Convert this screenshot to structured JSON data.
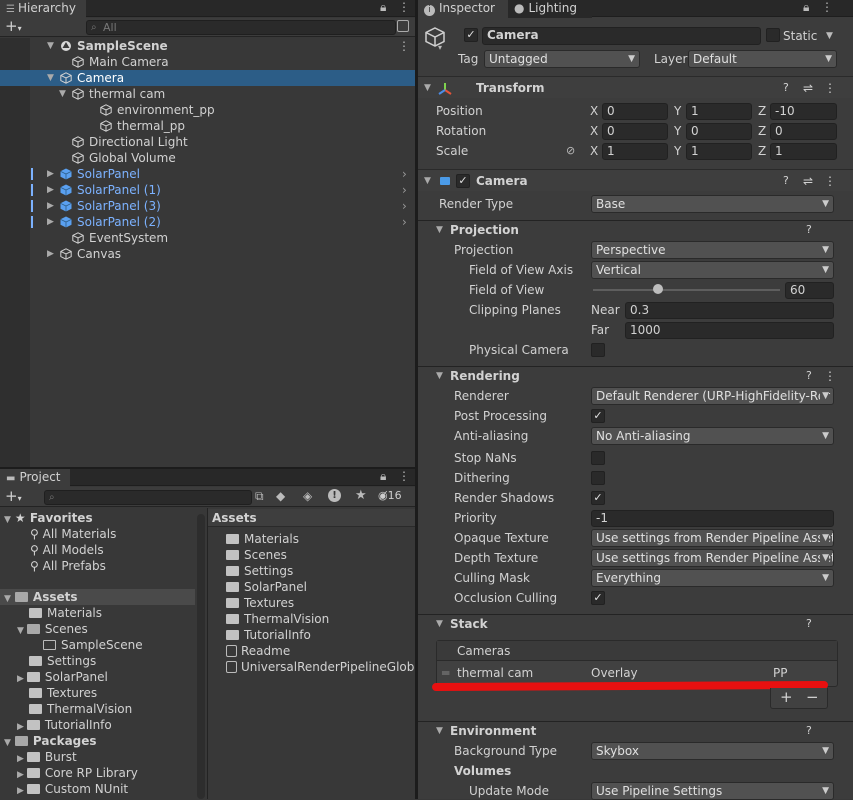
{
  "hierarchy": {
    "tab": "Hierarchy",
    "search_placeholder": "All",
    "add_label": "+",
    "items": [
      {
        "label": "SampleScene",
        "bold": true
      },
      {
        "label": "Main Camera"
      },
      {
        "label": "Camera",
        "selected": true
      },
      {
        "label": "thermal cam"
      },
      {
        "label": "environment_pp"
      },
      {
        "label": "thermal_pp"
      },
      {
        "label": "Directional Light"
      },
      {
        "label": "Global Volume"
      },
      {
        "label": "SolarPanel",
        "prefab": true
      },
      {
        "label": "SolarPanel (1)",
        "prefab": true
      },
      {
        "label": "SolarPanel (3)",
        "prefab": true
      },
      {
        "label": "SolarPanel (2)",
        "prefab": true
      },
      {
        "label": "EventSystem"
      },
      {
        "label": "Canvas"
      }
    ]
  },
  "project": {
    "tab": "Project",
    "add_label": "+",
    "hidden_count": "16",
    "favorites": {
      "label": "Favorites",
      "items": [
        "All Materials",
        "All Models",
        "All Prefabs"
      ]
    },
    "tree": {
      "assets_label": "Assets",
      "items": [
        "Materials",
        "Scenes",
        "SampleScene",
        "Settings",
        "SolarPanel",
        "Textures",
        "ThermalVision",
        "TutorialInfo"
      ],
      "packages_label": "Packages",
      "packages": [
        "Burst",
        "Core RP Library",
        "Custom NUnit"
      ]
    },
    "assets_header": "Assets",
    "assets_list": [
      "Materials",
      "Scenes",
      "Settings",
      "SolarPanel",
      "Textures",
      "ThermalVision",
      "TutorialInfo",
      "Readme",
      "UniversalRenderPipelineGlobal"
    ]
  },
  "inspector": {
    "tab": "Inspector",
    "tab2": "Lighting",
    "object_name": "Camera",
    "static_label": "Static",
    "tag_label": "Tag",
    "tag_value": "Untagged",
    "layer_label": "Layer",
    "layer_value": "Default",
    "transform": {
      "title": "Transform",
      "position_label": "Position",
      "position": [
        "0",
        "1",
        "-10"
      ],
      "rotation_label": "Rotation",
      "rotation": [
        "0",
        "0",
        "0"
      ],
      "scale_label": "Scale",
      "scale": [
        "1",
        "1",
        "1"
      ],
      "axis": [
        "X",
        "Y",
        "Z"
      ]
    },
    "camera": {
      "title": "Camera",
      "render_type_label": "Render Type",
      "render_type": "Base",
      "projection_section": "Projection",
      "projection_label": "Projection",
      "projection": "Perspective",
      "fov_axis_label": "Field of View Axis",
      "fov_axis": "Vertical",
      "fov_label": "Field of View",
      "fov": "60",
      "fov_fraction": 0.345,
      "clipping_label": "Clipping Planes",
      "near_label": "Near",
      "near": "0.3",
      "far_label": "Far",
      "far": "1000",
      "physical_label": "Physical Camera",
      "rendering_section": "Rendering",
      "renderer_label": "Renderer",
      "renderer": "Default Renderer (URP-HighFidelity-Rer",
      "post_label": "Post Processing",
      "aa_label": "Anti-aliasing",
      "aa": "No Anti-aliasing",
      "stopnan_label": "Stop NaNs",
      "dither_label": "Dithering",
      "shadows_label": "Render Shadows",
      "priority_label": "Priority",
      "priority": "-1",
      "opaque_label": "Opaque Texture",
      "opaque": "Use settings from Render Pipeline Asset",
      "depth_label": "Depth Texture",
      "depth": "Use settings from Render Pipeline Asset",
      "culling_label": "Culling Mask",
      "culling": "Everything",
      "occlusion_label": "Occlusion Culling",
      "stack_section": "Stack",
      "cameras_label": "Cameras",
      "stack_item_name": "thermal cam",
      "stack_item_type": "Overlay",
      "stack_item_pp": "PP",
      "plus": "+",
      "minus": "−",
      "environment_section": "Environment",
      "bg_label": "Background Type",
      "bg": "Skybox",
      "volumes_label": "Volumes",
      "update_label": "Update Mode",
      "update": "Use Pipeline Settings"
    }
  },
  "colors": {
    "selection": "#2c5d87",
    "prefab": "#7cb2ff",
    "annotation": "#e81010"
  }
}
